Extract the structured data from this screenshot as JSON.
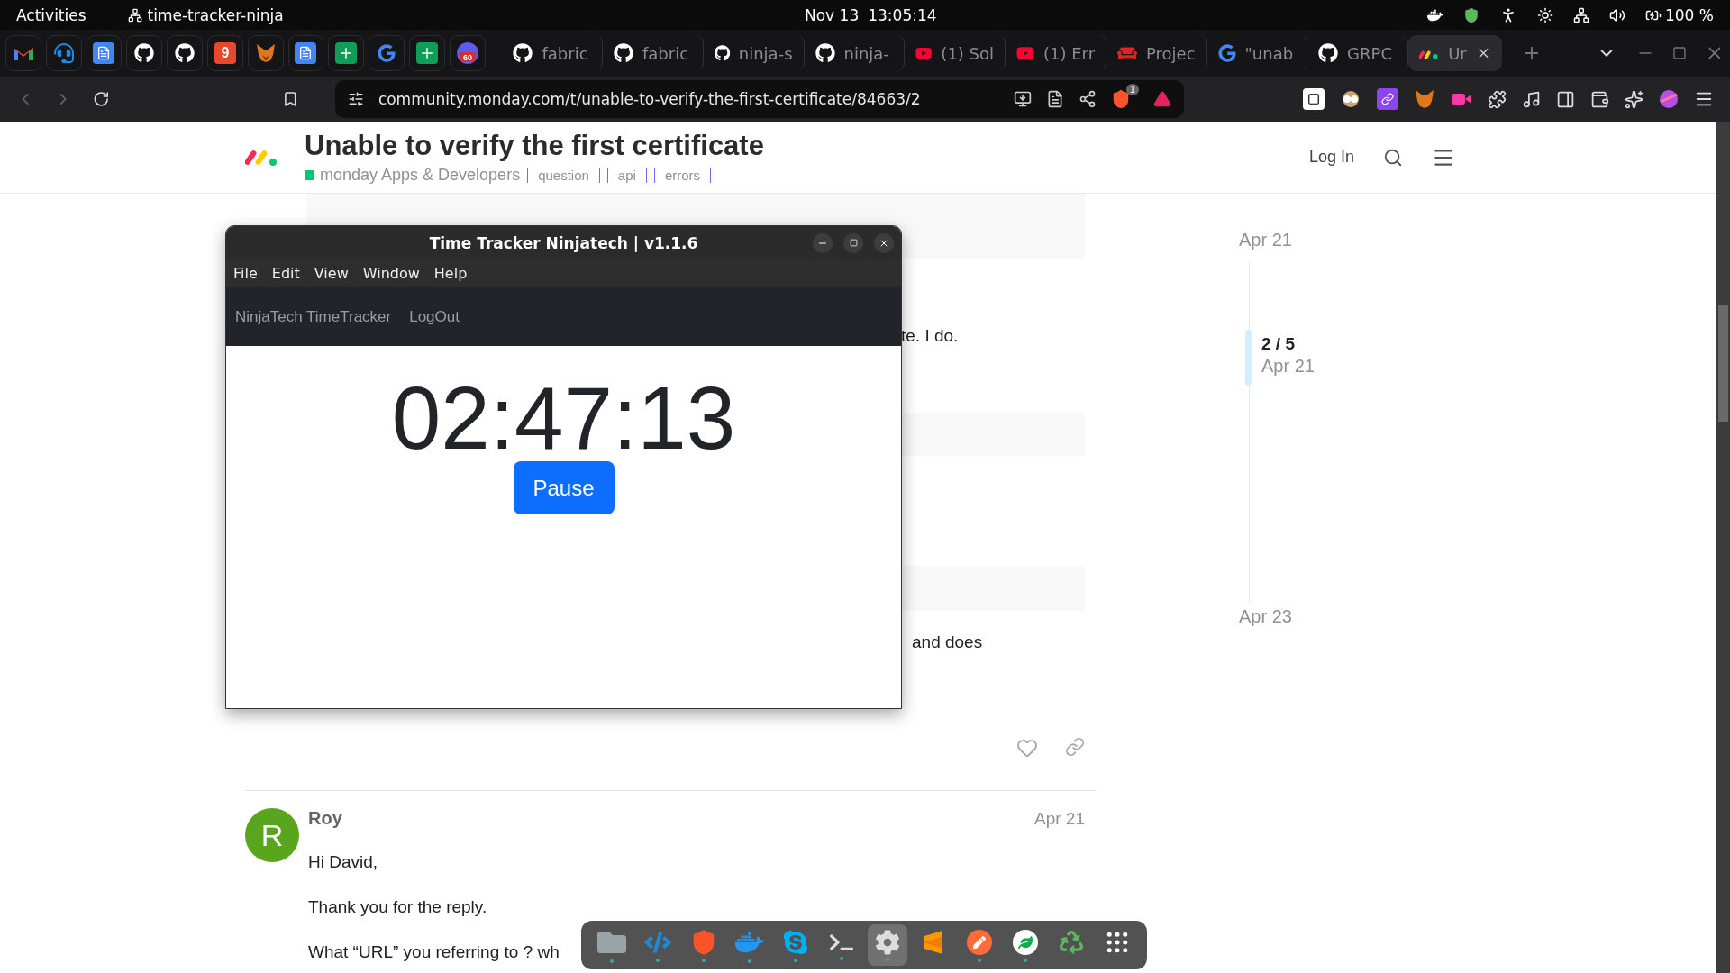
{
  "topbar": {
    "activities": "Activities",
    "app": "time-tracker-ninja",
    "date": "Nov 13",
    "time": "13:05:14",
    "battery": "100 %"
  },
  "pinned_tabs": [
    {
      "kind": "mail"
    },
    {
      "kind": "headset"
    },
    {
      "kind": "doc"
    },
    {
      "kind": "github"
    },
    {
      "kind": "github"
    },
    {
      "kind": "tile",
      "text": "9"
    },
    {
      "kind": "fox"
    },
    {
      "kind": "doc"
    },
    {
      "kind": "sheet"
    },
    {
      "kind": "google"
    },
    {
      "kind": "sheet"
    },
    {
      "kind": "calendar",
      "text": "60"
    }
  ],
  "tabs": [
    {
      "kind": "github",
      "title": "fabric",
      "selected": false
    },
    {
      "kind": "github",
      "title": "fabric",
      "selected": false
    },
    {
      "kind": "github",
      "title": "ninja-s",
      "selected": false
    },
    {
      "kind": "github",
      "title": "ninja-",
      "selected": false
    },
    {
      "kind": "youtube",
      "title": "(1) Sol",
      "selected": false
    },
    {
      "kind": "youtube",
      "title": "(1) Err",
      "selected": false
    },
    {
      "kind": "couch",
      "title": "Projec",
      "selected": false
    },
    {
      "kind": "google",
      "title": "\"unab",
      "selected": false
    },
    {
      "kind": "github",
      "title": "GRPC",
      "selected": false
    },
    {
      "kind": "monday",
      "title": "Ur",
      "selected": true
    }
  ],
  "address_bar": {
    "url": "community.monday.com/t/unable-to-verify-the-first-certificate/84663/2",
    "shield_badge": "1"
  },
  "topic": {
    "title": "Unable to verify the first certificate",
    "category": "monday Apps & Developers",
    "tags": [
      "question",
      "api",
      "errors"
    ],
    "login": "Log In"
  },
  "fragments": [
    "te. I do.",
    "and does"
  ],
  "post": {
    "author": "Roy",
    "avatar_letter": "R",
    "date": "Apr 21",
    "paragraphs": [
      {
        "text": "Hi David,"
      },
      {
        "text": "Thank you for the reply."
      },
      {
        "text": "What “URL” you referring to ? wh"
      }
    ]
  },
  "timeline": {
    "start": "Apr 21",
    "position": "2 / 5",
    "position_date": "Apr 21",
    "end": "Apr 23"
  },
  "app_window": {
    "title": "Time Tracker Ninjatech | v1.1.6",
    "menu": [
      "File",
      "Edit",
      "View",
      "Window",
      "Help"
    ],
    "nav": [
      "NinjaTech TimeTracker",
      "LogOut"
    ],
    "timer": "02:47:13",
    "button": "Pause"
  },
  "dock": [
    {
      "kind": "files",
      "running": true
    },
    {
      "kind": "code",
      "running": true
    },
    {
      "kind": "brave",
      "running": true
    },
    {
      "kind": "docker",
      "running": true
    },
    {
      "kind": "skype",
      "running": true
    },
    {
      "kind": "terminal",
      "running": true
    },
    {
      "kind": "settings",
      "running": true,
      "selected": true
    },
    {
      "kind": "sublime",
      "running": false
    },
    {
      "kind": "postman",
      "running": true
    },
    {
      "kind": "mongo",
      "running": true
    },
    {
      "kind": "trash",
      "running": false
    },
    {
      "kind": "apps",
      "running": false
    }
  ]
}
